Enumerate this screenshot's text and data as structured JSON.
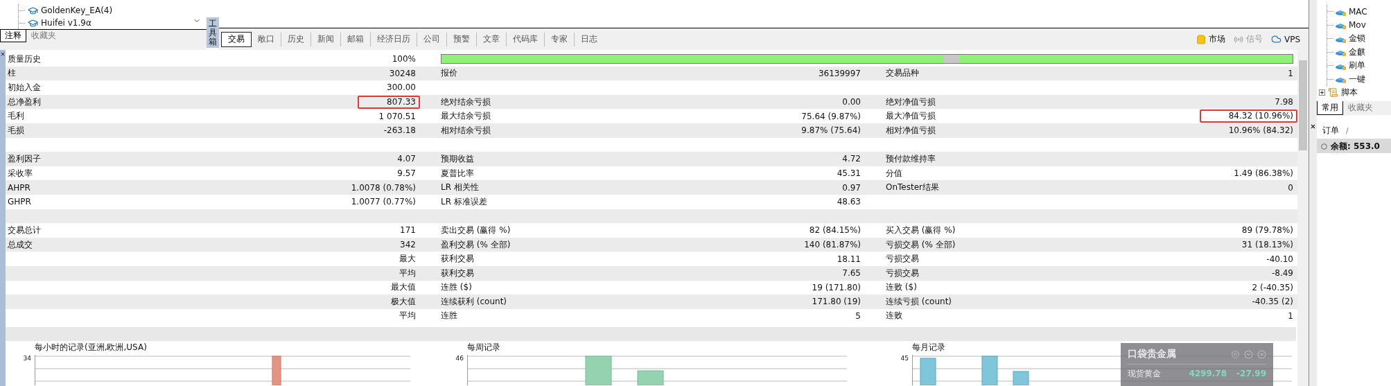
{
  "explorer": {
    "items": [
      {
        "label": "GoldenKey_EA(4)"
      },
      {
        "label": "Huifei v1.9α"
      }
    ],
    "tabs": [
      {
        "label": "注释",
        "selected": true
      },
      {
        "label": "收藏夹",
        "selected": false
      }
    ]
  },
  "toolbox_label": "工具箱",
  "tabs": [
    {
      "label": "交易",
      "selected": true
    },
    {
      "label": "敞口",
      "selected": false
    },
    {
      "label": "历史",
      "selected": false
    },
    {
      "label": "新闻",
      "selected": false
    },
    {
      "label": "邮箱",
      "selected": false
    },
    {
      "label": "经济日历",
      "selected": false
    },
    {
      "label": "公司",
      "selected": false
    },
    {
      "label": "预警",
      "selected": false
    },
    {
      "label": "文章",
      "selected": false
    },
    {
      "label": "代码库",
      "selected": false
    },
    {
      "label": "专家",
      "selected": false
    },
    {
      "label": "日志",
      "selected": false
    }
  ],
  "toolbar": [
    {
      "kind": "market",
      "label": "市场",
      "disabled": false
    },
    {
      "kind": "signal",
      "label": "信号",
      "disabled": true
    },
    {
      "kind": "vps",
      "label": "VPS",
      "disabled": false
    }
  ],
  "report": {
    "rows": [
      {
        "label": "质量历史",
        "value": "100%",
        "progress": {
          "level": 1
        }
      },
      {
        "label": "柱",
        "value": "30248",
        "label2": "报价",
        "value2": "36139997",
        "label3": "交易品种",
        "value3": "1"
      },
      {
        "label": "初始入金",
        "value": "300.00"
      },
      {
        "label": "总净盈利",
        "value": "807.33",
        "value_marked": true,
        "label2": "绝对结余亏损",
        "value2": "0.00",
        "label3": "绝对净值亏损",
        "value3": "7.98"
      },
      {
        "label": "毛利",
        "value": "1 070.51",
        "label2": "最大结余亏损",
        "value2": "75.64 (9.87%)",
        "label3": "最大净值亏损",
        "value3": "84.32 (10.96%)",
        "value3_marked": true
      },
      {
        "label": "毛损",
        "value": "-263.18",
        "label2": "相对结余亏损",
        "value2": "9.87% (75.64)",
        "label3": "相对净值亏损",
        "value3": "10.96% (84.32)"
      },
      {},
      {
        "label": "盈利因子",
        "value": "4.07",
        "label2": "预期收益",
        "value2": "4.72",
        "label3": "预付款维持率"
      },
      {
        "label": "采收率",
        "value": "9.57",
        "label2": "夏普比率",
        "value2": "45.31",
        "label3": "分值",
        "value3": "1.49 (86.38%)"
      },
      {
        "label": "AHPR",
        "value": "1.0078 (0.78%)",
        "label2": "LR 相关性",
        "value2": "0.97",
        "label3": "OnTester结果",
        "value3": "0"
      },
      {
        "label": "GHPR",
        "value": "1.0077 (0.77%)",
        "label2": "LR 标准误差",
        "value2": "48.63"
      },
      {},
      {
        "label": "交易总计",
        "value": "171",
        "label2": "卖出交易 (赢得 %)",
        "value2": "82 (84.15%)",
        "label3": "买入交易 (赢得 %)",
        "value3": "89 (79.78%)"
      },
      {
        "label": "总成交",
        "value": "342",
        "label2": "盈利交易 (% 全部)",
        "value2": "140 (81.87%)",
        "label3": "亏损交易 (% 全部)",
        "value3": "31 (18.13%)"
      },
      {
        "value": "最大",
        "label2": "获利交易",
        "value2": "18.11",
        "label3": "亏损交易",
        "value3": "-40.10"
      },
      {
        "value": "平均",
        "label2": "获利交易",
        "value2": "7.65",
        "label3": "亏损交易",
        "value3": "-8.49"
      },
      {
        "value": "最大值",
        "label2": "连胜 ($)",
        "value2": "19 (171.80)",
        "label3": "连败 ($)",
        "value3": "2 (-40.35)"
      },
      {
        "value": "极大值",
        "label2": "连续获利 (count)",
        "value2": "171.80 (19)",
        "label3": "连续亏损 (count)",
        "value3": "-40.35 (2)"
      },
      {
        "value": "平均",
        "label2": "连胜",
        "value2": "5",
        "label3": "连败",
        "value3": "1"
      }
    ]
  },
  "charts": [
    {
      "title": "每小时的记录(亚洲,欧洲,USA)",
      "top_tick": "34"
    },
    {
      "title": "每周记录",
      "top_tick": "46"
    },
    {
      "title": "每月记录",
      "top_tick": "45"
    }
  ],
  "navigator": {
    "items": [
      {
        "label": "MAC"
      },
      {
        "label": "Mov"
      },
      {
        "label": "金锁"
      },
      {
        "label": "金麒"
      },
      {
        "label": "刷单"
      },
      {
        "label": "一键"
      }
    ],
    "group": {
      "label": "脚本",
      "expanded": false
    },
    "tabs": [
      {
        "label": "常用",
        "selected": true
      },
      {
        "label": "收藏夹",
        "selected": false
      }
    ]
  },
  "orders": {
    "column": "订单",
    "sort_mark": "/",
    "balance": "余额: 553.0"
  },
  "widget": {
    "title": "口袋贵金属",
    "quotes": [
      {
        "name": "现货黄金",
        "price": "4299.78",
        "change": "-27.99"
      }
    ]
  }
}
